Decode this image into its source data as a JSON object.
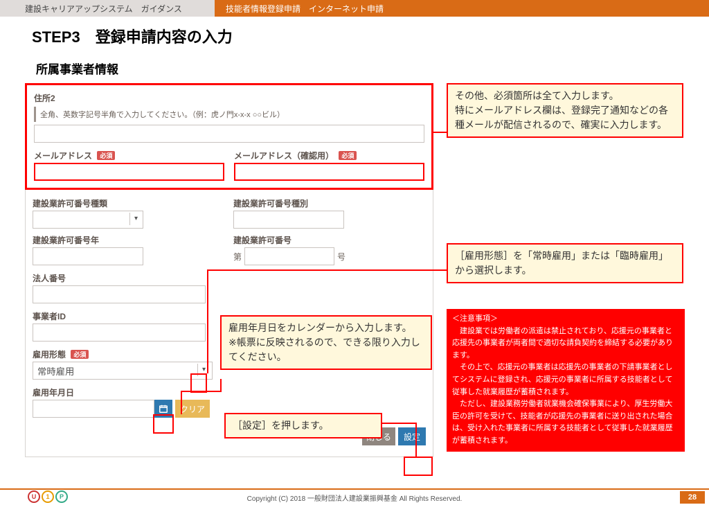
{
  "header": {
    "left": "建設キャリアアップシステム　ガイダンス",
    "right": "技能者情報登録申請　インターネット申請"
  },
  "step_title": "STEP3　登録申請内容の入力",
  "subsection": "所属事業者情報",
  "form": {
    "addr2_label": "住所2",
    "addr2_hint": "全角、英数字記号半角で入力してください。（例：虎ノ門x-x-x ○○ビル）",
    "email_label": "メールアドレス",
    "email_confirm_label": "メールアドレス（確認用）",
    "required_badge": "必須",
    "permit_type_label": "建設業許可番号種類",
    "permit_kind_label": "建設業許可番号種別",
    "permit_year_label": "建設業許可番号年",
    "permit_number_label": "建設業許可番号",
    "permit_prefix": "第",
    "permit_suffix": "号",
    "corp_no_label": "法人番号",
    "biz_id_label": "事業者ID",
    "emp_type_label": "雇用形態",
    "emp_type_value": "常時雇用",
    "emp_date_label": "雇用年月日",
    "clear_btn": "クリア",
    "close_btn": "閉じる",
    "set_btn": "設定"
  },
  "callouts": {
    "c1": "その他、必須箇所は全て入力します。\n特にメールアドレス欄は、登録完了通知などの各種メールが配信されるので、確実に入力します。",
    "c2": "［雇用形態］を「常時雇用」または「臨時雇用」から選択します。",
    "c3": "雇用年月日をカレンダーから入力します。\n※帳票に反映されるので、できる限り入力してください。",
    "c4": "［設定］を押します。"
  },
  "red_note": {
    "title": "＜注意事項＞",
    "body": "　建設業では労働者の派遣は禁止されており、応援元の事業者と応援先の事業者が両者間で適切な請負契約を締結する必要があります。\n　その上で、応援元の事業者は応援先の事業者の下請事業者としてシステムに登録され、応援元の事業者に所属する技能者として従事した就業履歴が蓄積されます。\n　ただし、建設業務労働者就業機会確保事業により、厚生労働大臣の許可を受けて、技能者が応援先の事業者に送り出された場合は、受け入れた事業者に所属する技能者として従事した就業履歴が蓄積されます。"
  },
  "footer": {
    "copyright": "Copyright (C) 2018 一般財団法人建設業振興基金 All Rights Reserved.",
    "page": "28"
  }
}
